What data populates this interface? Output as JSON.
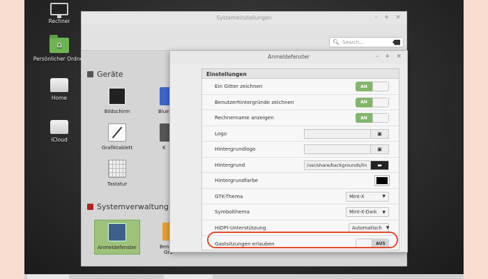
{
  "desktop": {
    "icons": [
      {
        "label": "Rechner",
        "icon": "computer-icon"
      },
      {
        "label": "Persönlicher Ordner",
        "icon": "home-folder-icon"
      },
      {
        "label": "Home",
        "icon": "drive-icon"
      },
      {
        "label": "iCloud",
        "icon": "drive-icon"
      }
    ]
  },
  "main_window": {
    "title": "Systemeinstellungen",
    "controls": {
      "minimize": "–",
      "maximize": "+",
      "close": "×"
    },
    "search_placeholder": "Search...",
    "sections": {
      "hardware": {
        "title": "Geräte",
        "applets": [
          "Bildschirm",
          "Grafiktablett",
          "Tastatur",
          "Blue",
          "K"
        ]
      },
      "admin": {
        "title": "Systemverwaltung",
        "applets": [
          "Anmeldefenster",
          "Benut",
          "Gru"
        ]
      }
    }
  },
  "dialog": {
    "title": "Anmeldefenster",
    "controls": {
      "minimize": "–",
      "maximize": "+",
      "close": "×"
    },
    "panel_title": "Einstellungen",
    "rows": [
      {
        "label": "Ein Gitter zeichnen",
        "toggle": "AN"
      },
      {
        "label": "Benutzerhintergründe zeichnen",
        "toggle": "AN"
      },
      {
        "label": "Rechnername anzeigen",
        "toggle": "AN"
      },
      {
        "label": "Logo",
        "value": ""
      },
      {
        "label": "Hintergrundlogo",
        "value": ""
      },
      {
        "label": "Hintergrund",
        "value": "/usr/share/backgrounds/lin"
      },
      {
        "label": "Hintergrundfarbe",
        "color": "#000000"
      },
      {
        "label": "GTK-Thema",
        "value": "Mint-X"
      },
      {
        "label": "Symbolthema",
        "value": "Mint-X-Dark"
      },
      {
        "label": "HiDPI-Unterstützung",
        "value": "Automatisch"
      },
      {
        "label": "Gastsitzungen erlauben",
        "toggle": "AUS"
      }
    ]
  },
  "colors": {
    "accent_green": "#82b66b",
    "highlight_red": "#e24b2d"
  }
}
